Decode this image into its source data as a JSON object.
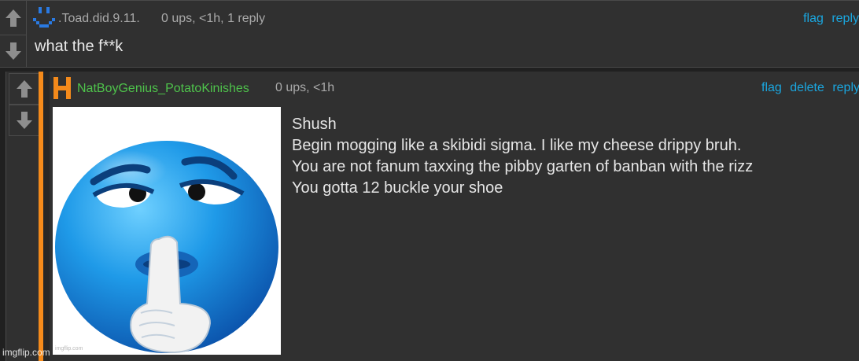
{
  "comment1": {
    "username": ".Toad.did.9.11.",
    "stats": "0 ups, <1h, 1 reply",
    "links": [
      "flag",
      "reply"
    ],
    "text": "what the f**k"
  },
  "comment2": {
    "username": "NatBoyGenius_PotatoKinishes",
    "stats": "0 ups, <1h",
    "links": [
      "flag",
      "delete",
      "reply"
    ],
    "image_watermark": "imgflip.com",
    "text": "Shush\nBegin mogging like a skibidi sigma. I like my cheese drippy bruh.\nYou are not fanum taxxing the pibby garten of banban with the rizz\nYou gotta 12 buckle your shoe"
  },
  "watermark": "imgflip.com",
  "colors": {
    "link": "#1aa7e0",
    "username_green": "#4ec24b",
    "reply_bar": "#f48a1b",
    "background": "#303030"
  },
  "icons": {
    "upvote": "arrow-up-icon",
    "downvote": "arrow-down-icon",
    "avatar1": "pixel-face-avatar",
    "avatar2": "letter-h-avatar",
    "image": "blue-shush-emoji"
  }
}
